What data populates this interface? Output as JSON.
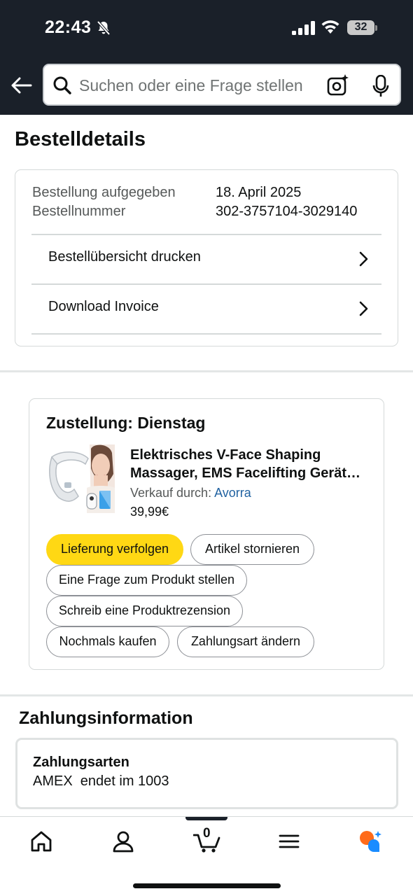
{
  "status_bar": {
    "time": "22:43",
    "battery": "32"
  },
  "search": {
    "placeholder": "Suchen oder eine Frage stellen"
  },
  "page_title": "Bestelldetails",
  "order": {
    "placed_label": "Bestellung aufgegeben",
    "placed_value": "18. April 2025",
    "number_label": "Bestellnummer",
    "number_value": "302-3757104-3029140",
    "links": [
      "Bestellübersicht drucken",
      "Download Invoice"
    ]
  },
  "shipment": {
    "title": "Zustellung: Dienstag",
    "product_title": "Elektrisches V-Face Shaping Massager, EMS Facelifting Gerät…",
    "seller_prefix": "Verkauf durch:",
    "seller_name": "Avorra",
    "price": "39,99€",
    "buttons": {
      "track": "Lieferung verfolgen",
      "cancel": "Artikel stornieren",
      "question": "Eine Frage zum Produkt stellen",
      "review": "Schreib eine Produktrezension",
      "buy_again": "Nochmals kaufen",
      "change_payment": "Zahlungsart ändern"
    }
  },
  "payment": {
    "heading": "Zahlungsinformation",
    "methods_label": "Zahlungsarten",
    "card": "AMEX  endet im 1003"
  },
  "nav": {
    "cart_count": "0"
  },
  "colors": {
    "header_bg": "#1a2029",
    "primary_button": "#ffd814",
    "link": "#2162a1"
  }
}
